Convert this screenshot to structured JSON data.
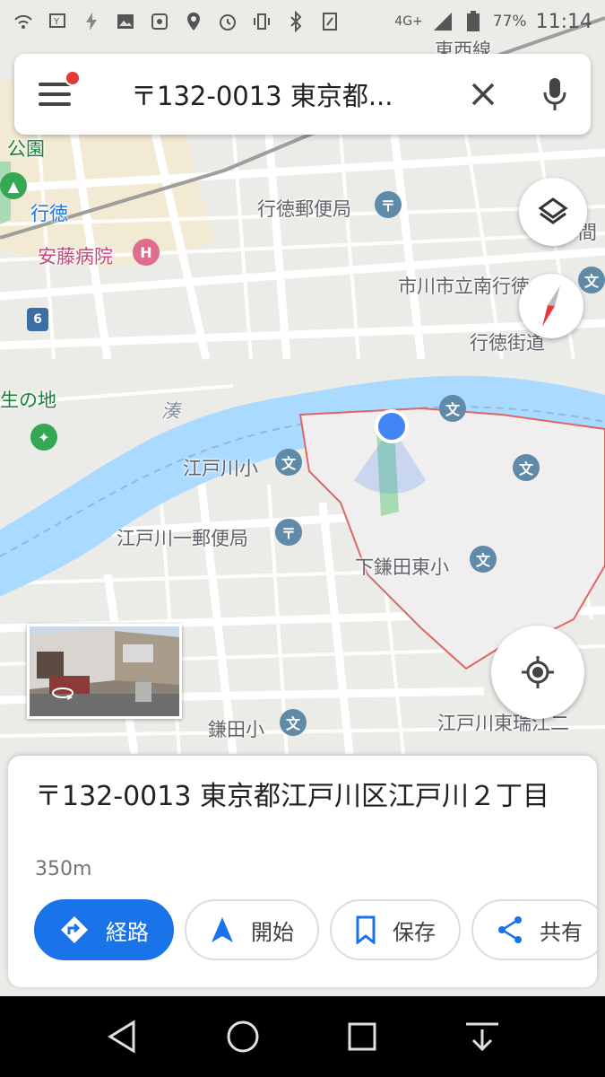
{
  "status_bar": {
    "battery": "77%",
    "time": "11:14",
    "network": "4G+",
    "icons": [
      "wifi-calling-icon",
      "voicemail-icon",
      "no-charge-icon",
      "image-icon",
      "settings-icon",
      "location-icon",
      "alarm-icon",
      "vibrate-icon",
      "bluetooth-icon",
      "nfc-icon",
      "signal-icon",
      "battery-icon"
    ]
  },
  "search": {
    "query": "〒132-0013 東京都...",
    "menu_icon": "hamburger-menu-icon",
    "clear_icon": "close-icon",
    "voice_icon": "microphone-icon"
  },
  "map": {
    "labels": {
      "park": "公園",
      "gyotoku": "行徳",
      "ando_hospital": "安藤病院",
      "gyotoku_post": "行徳郵便局",
      "ichikawa_school": "市川市立南行徳",
      "gyotoku_kaido": "行徳街道",
      "seinochi": "生の地",
      "minato": "湊",
      "edogawa_elem": "江戸川小",
      "edogawa_post": "江戸川一郵便局",
      "shimokamata_elem": "下鎌田東小",
      "kamata_elem": "鎌田小",
      "edogawa_higashi": "江戸川東瑞江二",
      "route6": "6",
      "ma": "間",
      "touzai": "東西線"
    }
  },
  "controls": {
    "layers_icon": "layers-icon",
    "compass_icon": "compass-icon",
    "my_location_icon": "my-location-icon",
    "streetview_icon": "360-view-icon"
  },
  "place_sheet": {
    "title": "〒132-0013 東京都江戸川区江戸川２丁目",
    "distance": "350m",
    "actions": [
      {
        "label": "経路",
        "icon": "directions-icon"
      },
      {
        "label": "開始",
        "icon": "navigation-arrow-icon"
      },
      {
        "label": "保存",
        "icon": "bookmark-icon"
      },
      {
        "label": "共有",
        "icon": "share-icon"
      }
    ]
  },
  "nav_bar": {
    "back_icon": "back-icon",
    "home_icon": "home-icon",
    "recents_icon": "recents-icon",
    "hide_icon": "hide-nav-icon"
  },
  "colors": {
    "accent": "#1a73e8",
    "river": "#aadaff",
    "boundary": "#e06666",
    "location_dot": "#4285f4"
  }
}
